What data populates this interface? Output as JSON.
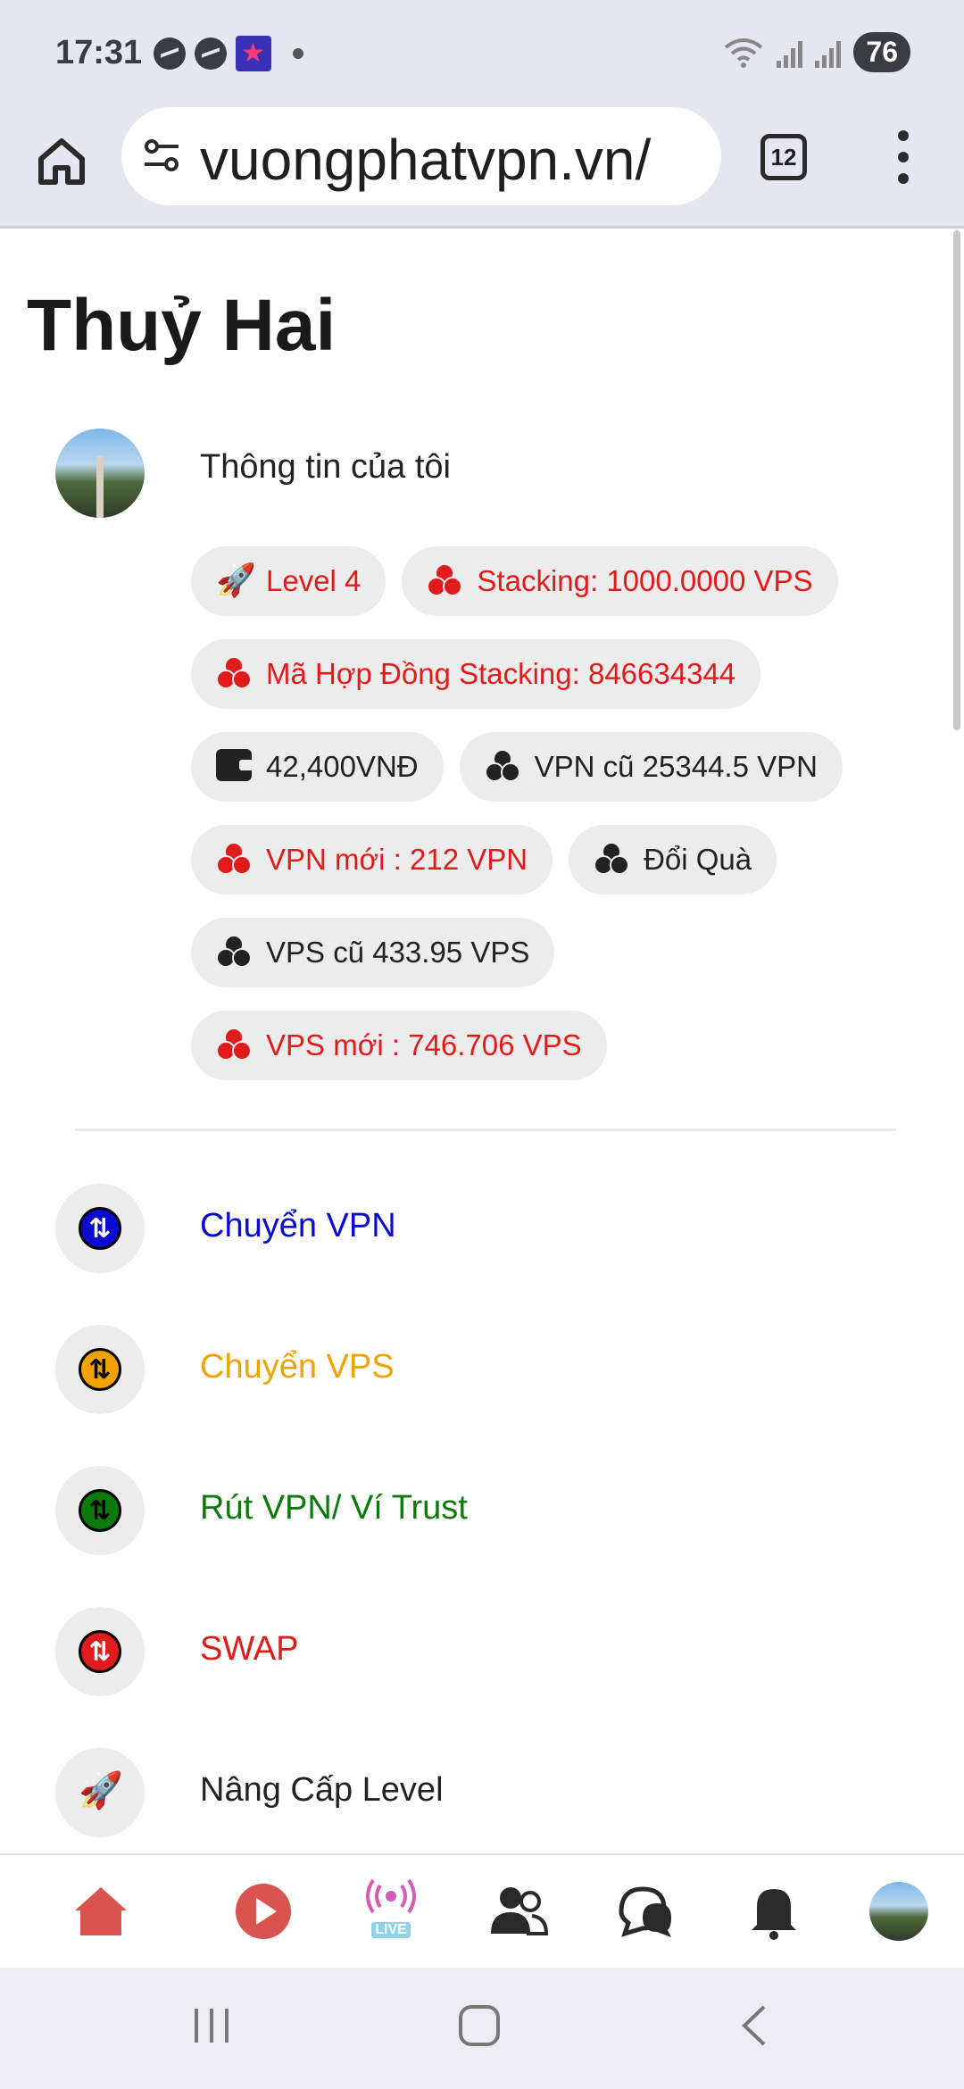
{
  "status_bar": {
    "time": "17:31",
    "battery": "76",
    "icons": [
      "messenger-icon",
      "messenger-icon",
      "app-icon",
      "dot-icon",
      "wifi-icon",
      "signal-icon",
      "signal-icon",
      "battery-icon"
    ]
  },
  "browser": {
    "url": "vuongphatvpn.vn/",
    "tab_count": "12"
  },
  "page": {
    "title": "Thuỷ Hai",
    "profile_label": "Thông tin của tôi"
  },
  "chips": [
    {
      "label": "Level 4",
      "color": "red",
      "icon": "rocket-icon"
    },
    {
      "label": "Stacking: 1000.0000 VPS",
      "color": "red",
      "icon": "coins-icon"
    },
    {
      "label": "Mã Hợp Đồng Stacking: 846634344",
      "color": "red",
      "icon": "coins-icon"
    },
    {
      "label": "42,400VNĐ",
      "color": "dark",
      "icon": "wallet-icon"
    },
    {
      "label": "VPN cũ 25344.5 VPN",
      "color": "dark",
      "icon": "coins-icon"
    },
    {
      "label": "VPN mới : 212 VPN",
      "color": "red",
      "icon": "coins-icon"
    },
    {
      "label": "Đổi Quà",
      "color": "dark",
      "icon": "coins-icon"
    },
    {
      "label": "VPS cũ 433.95 VPS",
      "color": "dark",
      "icon": "coins-icon"
    },
    {
      "label": "VPS mới : 746.706 VPS",
      "color": "red",
      "icon": "coins-icon"
    }
  ],
  "actions": [
    {
      "label": "Chuyển VPN",
      "color": "#0a0ad0",
      "icon": "transfer-icon"
    },
    {
      "label": "Chuyển VPS",
      "color": "#f0a300",
      "icon": "transfer-icon"
    },
    {
      "label": "Rút VPN/ Ví Trust",
      "color": "#0a7a0a",
      "icon": "transfer-icon"
    },
    {
      "label": "SWAP",
      "color": "#e01b1b",
      "icon": "transfer-icon"
    },
    {
      "label": "Nâng Cấp Level",
      "color": "#222222",
      "icon": "rocket-icon"
    }
  ],
  "bottom_nav": {
    "items": [
      "home-icon",
      "play-icon",
      "live-icon",
      "friends-icon",
      "chat-icon",
      "bell-icon",
      "profile-avatar"
    ],
    "live_label": "LIVE"
  },
  "colors": {
    "accent_red": "#e01b1b",
    "blue": "#0a0ad0",
    "orange": "#f0a300",
    "green": "#0a7a0a",
    "chip_bg": "#ececec"
  }
}
